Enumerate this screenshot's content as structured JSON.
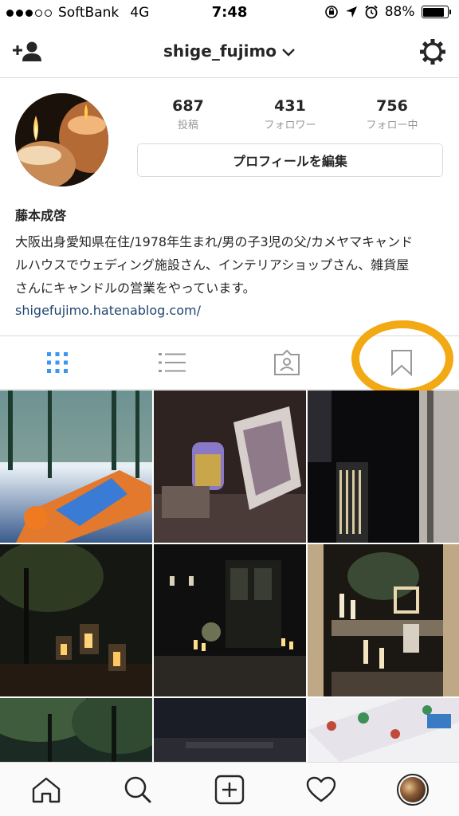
{
  "status_bar": {
    "carrier": "SoftBank",
    "network": "4G",
    "time": "7:48",
    "battery": "88%",
    "battery_level": 0.88
  },
  "nav": {
    "title": "shige_fujimo",
    "add_user_icon": "add-user-icon",
    "settings_icon": "gear-icon",
    "chevron_icon": "chevron-down-icon"
  },
  "stats": [
    {
      "value": "687",
      "label": "投稿"
    },
    {
      "value": "431",
      "label": "フォロワー"
    },
    {
      "value": "756",
      "label": "フォロー中"
    }
  ],
  "edit_profile_label": "プロフィールを編集",
  "bio": {
    "name": "藤本成啓",
    "line1": "大阪出身愛知県在住/1978年生まれ/男の子3児の父/カメヤマキャンド",
    "line2": "ルハウスでウェディング施設さん、インテリアショップさん、雑貨屋",
    "line3": "さんにキャンドルの営業をやっています。",
    "link": "shigefujimo.hatenablog.com/"
  },
  "tabs": [
    {
      "name": "grid",
      "icon": "grid-icon",
      "active": true
    },
    {
      "name": "list",
      "icon": "list-icon",
      "active": false
    },
    {
      "name": "tagged",
      "icon": "tagged-photos-icon",
      "active": false
    },
    {
      "name": "saved",
      "icon": "bookmark-icon",
      "active": false
    }
  ],
  "colors": {
    "accent": "#3897f0",
    "highlight_ring": "#f2a913",
    "link": "#1f4570",
    "border": "#dbdbdb"
  },
  "bottom_bar": [
    "home-icon",
    "search-icon",
    "add-post-icon",
    "heart-icon",
    "profile-avatar"
  ]
}
